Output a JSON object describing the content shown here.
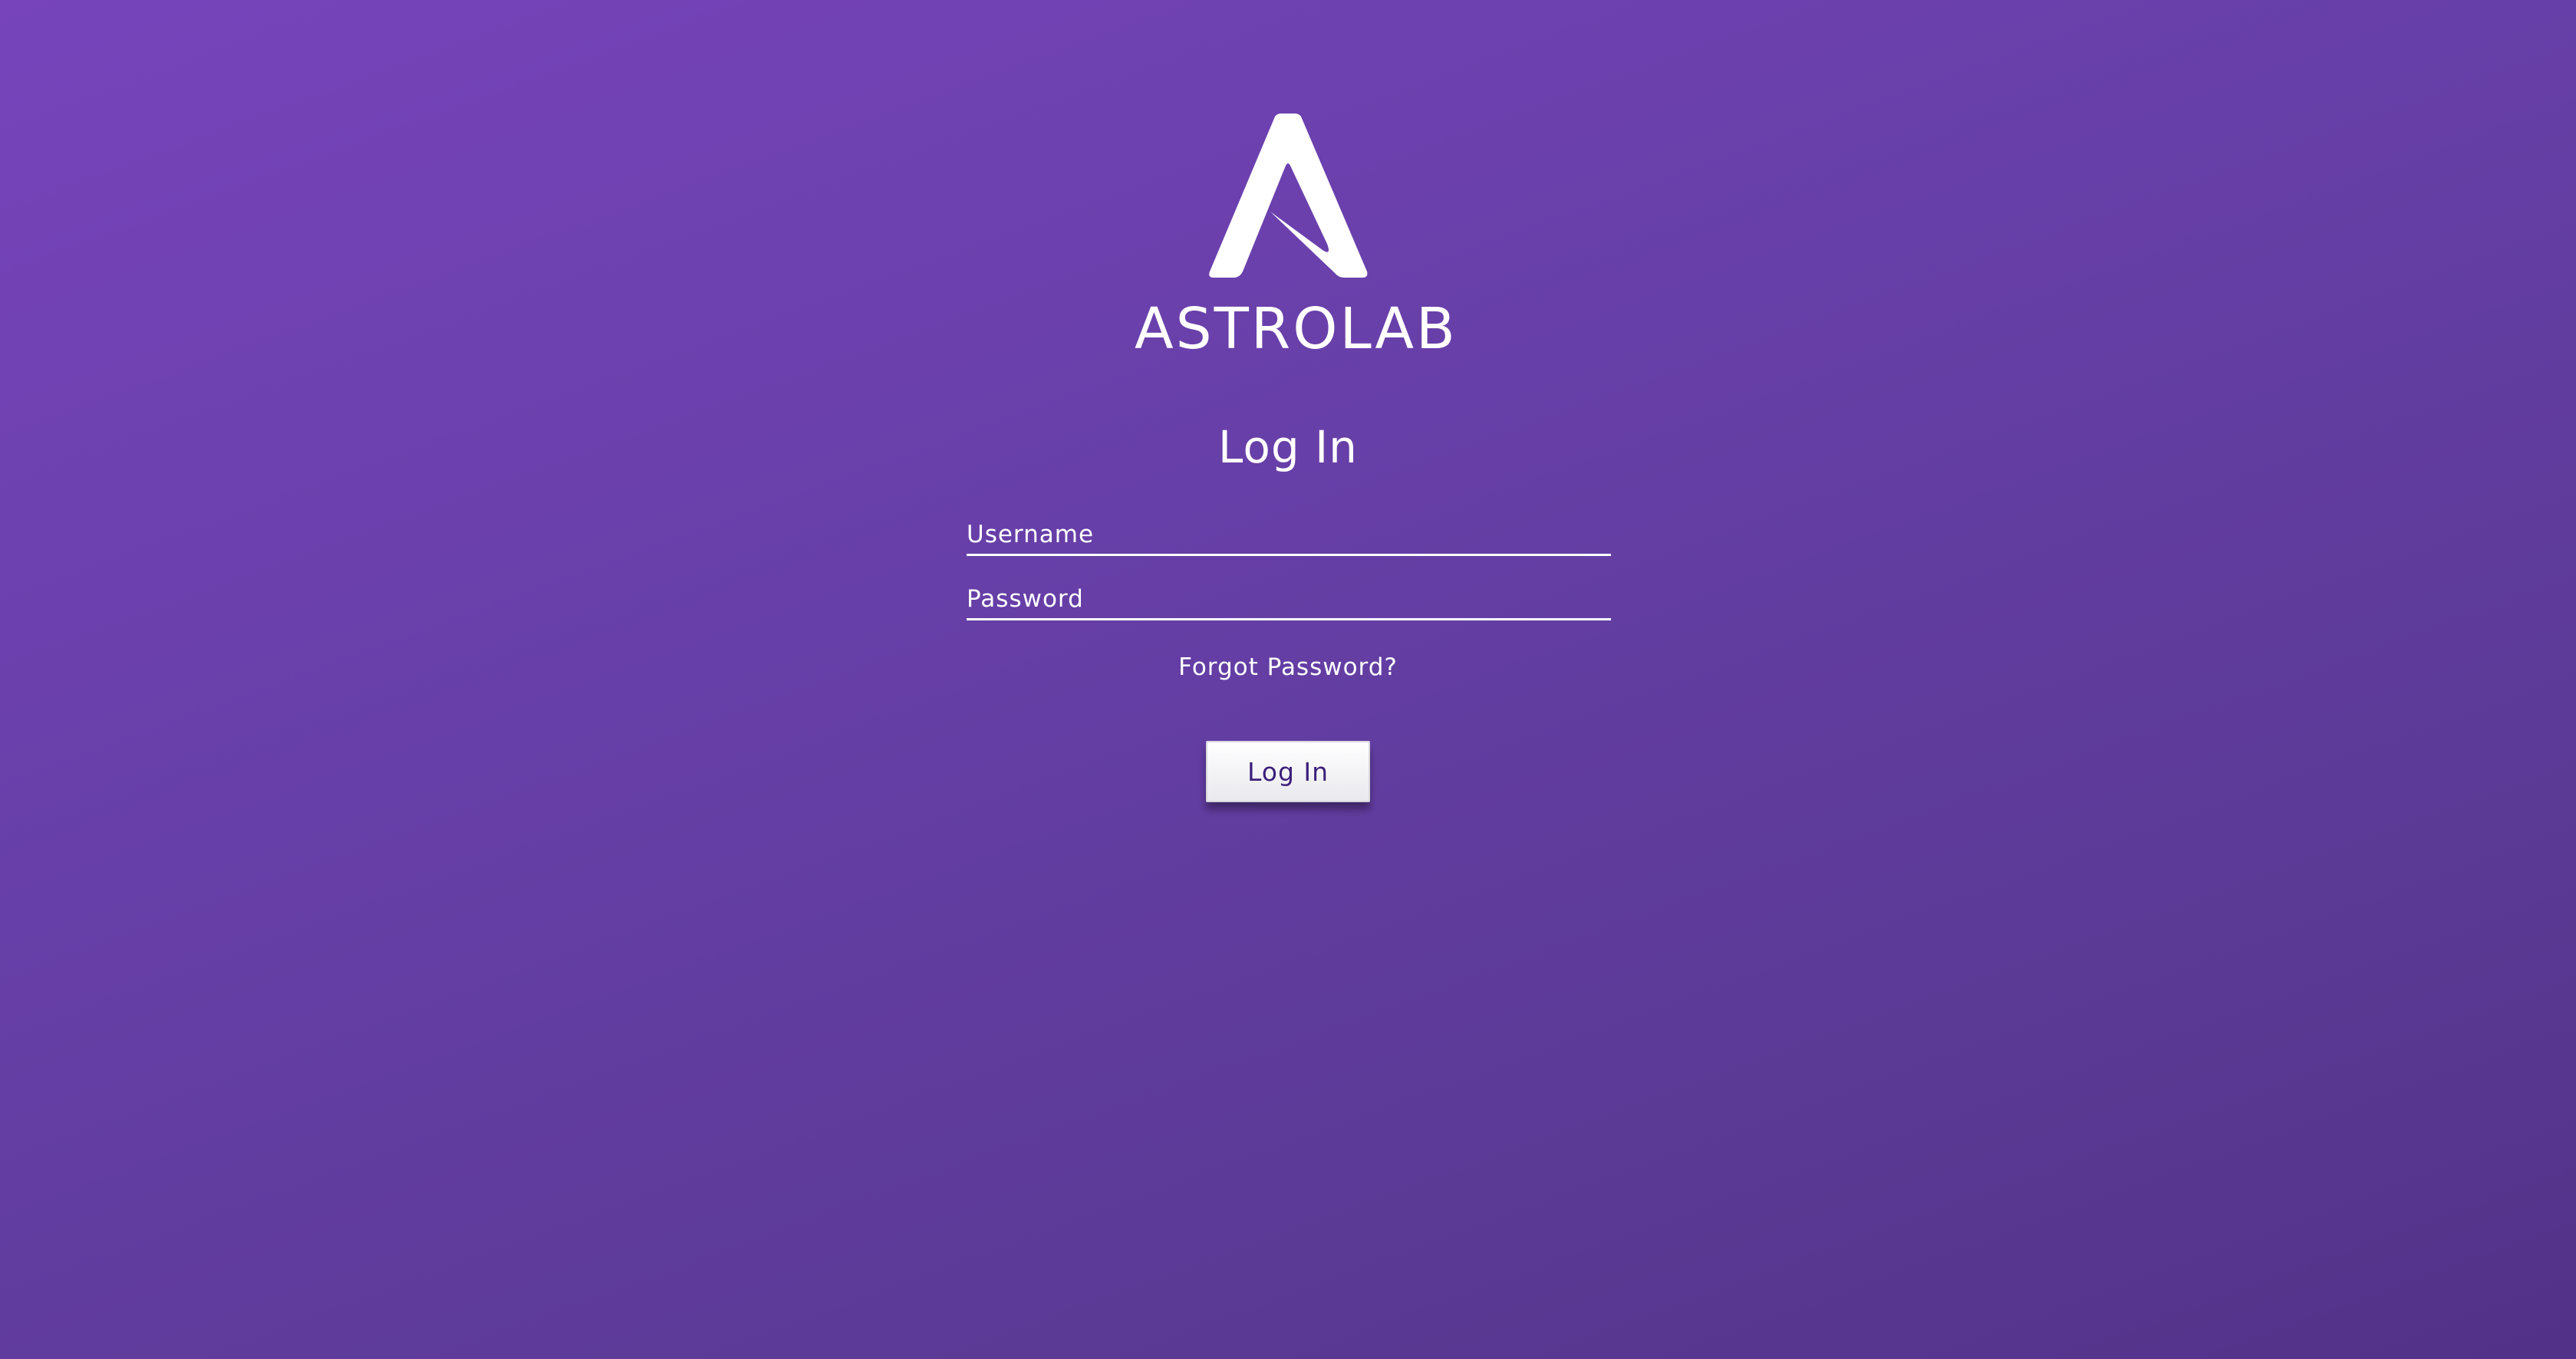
{
  "brand": {
    "name": "ASTROLAB",
    "logo_icon": "astrolab-a-logo-icon"
  },
  "login": {
    "title": "Log In",
    "username_placeholder": "Username",
    "password_placeholder": "Password",
    "forgot_link": "Forgot Password?",
    "submit_label": "Log In"
  },
  "colors": {
    "background_start": "#7744bb",
    "background_end": "#523288",
    "text": "#ffffff",
    "button_text": "#3b1f7a"
  }
}
